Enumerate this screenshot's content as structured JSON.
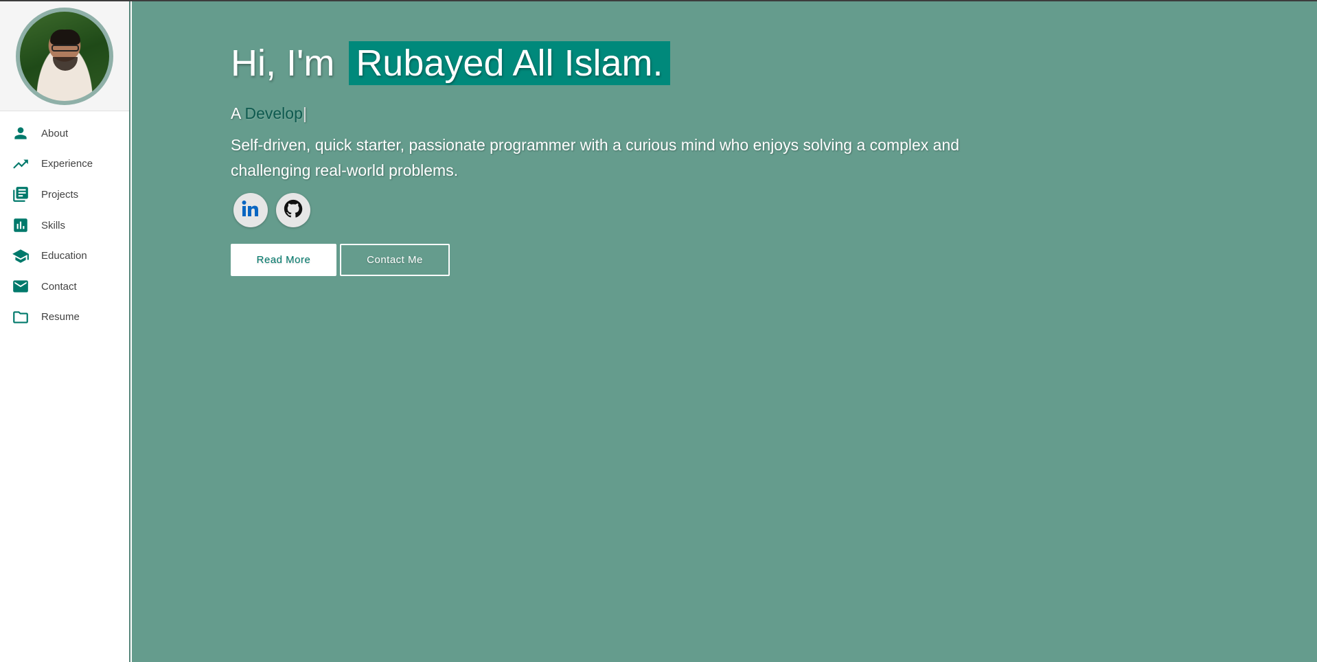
{
  "sidebar": {
    "items": [
      {
        "label": "About",
        "icon": "person-icon"
      },
      {
        "label": "Experience",
        "icon": "trending-up-icon"
      },
      {
        "label": "Projects",
        "icon": "library-books-icon"
      },
      {
        "label": "Skills",
        "icon": "bar-chart-icon"
      },
      {
        "label": "Education",
        "icon": "graduation-cap-icon"
      },
      {
        "label": "Contact",
        "icon": "email-icon"
      },
      {
        "label": "Resume",
        "icon": "folder-icon"
      }
    ]
  },
  "hero": {
    "greeting": "Hi, I'm",
    "name": "Rubayed All Islam.",
    "role_prefix": "A",
    "role_typed": "Develop",
    "cursor": "|",
    "tagline": "Self-driven, quick starter, passionate programmer with a curious mind who enjoys solving a complex and challenging real-world problems.",
    "socials": [
      {
        "icon": "linkedin-icon"
      },
      {
        "icon": "github-icon"
      }
    ],
    "read_more_label": "Read More",
    "contact_label": "Contact Me"
  },
  "colors": {
    "accent": "#00796b",
    "name_highlight": "#00897b",
    "main_bg": "#659c8d",
    "sidebar_bg": "#ffffff"
  }
}
